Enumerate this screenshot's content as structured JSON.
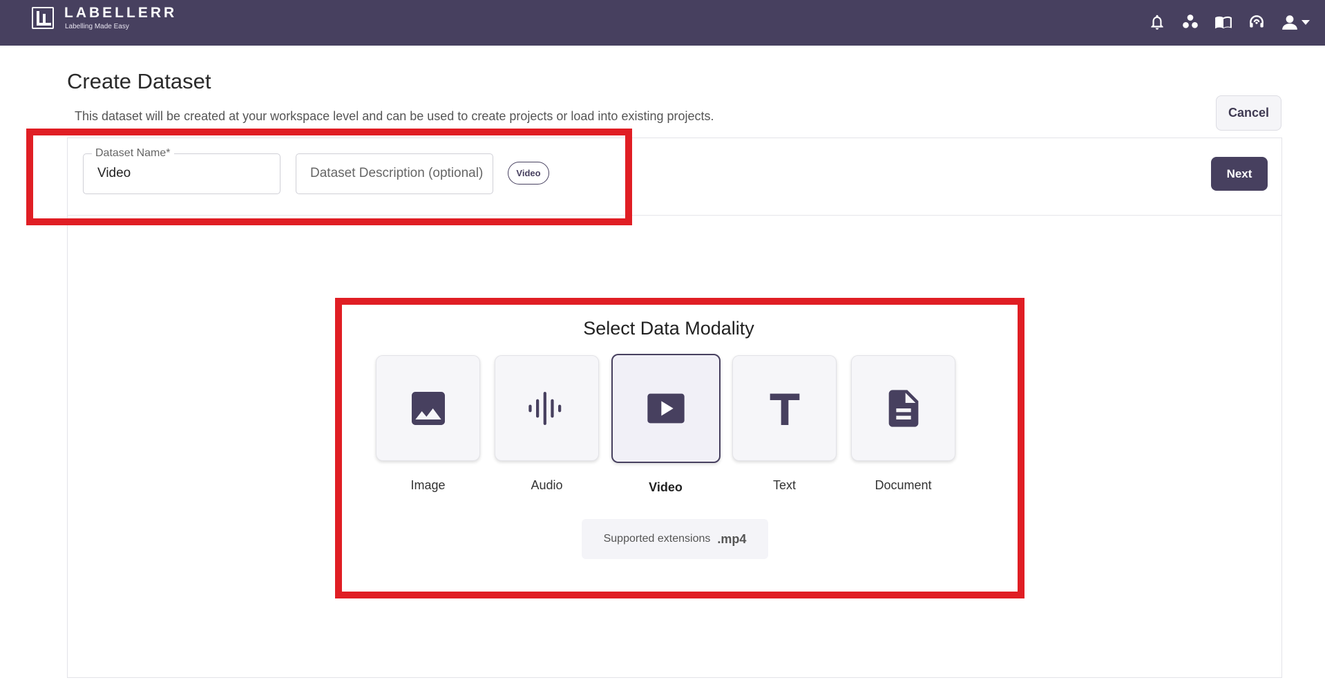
{
  "header": {
    "brand_name": "LABELLERR",
    "brand_tagline": "Labelling Made Easy",
    "icons": [
      "bell-icon",
      "dots-icon",
      "book-icon",
      "headset-icon",
      "user-icon"
    ]
  },
  "page": {
    "title": "Create Dataset",
    "subtitle": "This dataset will be created at your workspace level and can be used to create projects or load into existing projects.",
    "cancel_label": "Cancel",
    "next_label": "Next"
  },
  "form": {
    "name_label": "Dataset Name*",
    "name_value": "Video",
    "description_placeholder": "Dataset Description (optional)",
    "type_chip": "Video"
  },
  "modality": {
    "title": "Select Data Modality",
    "options": [
      {
        "label": "Image",
        "icon": "image-icon"
      },
      {
        "label": "Audio",
        "icon": "audio-icon"
      },
      {
        "label": "Video",
        "icon": "video-icon"
      },
      {
        "label": "Text",
        "icon": "text-icon"
      },
      {
        "label": "Document",
        "icon": "document-icon"
      }
    ],
    "selected": "Video",
    "ext_label": "Supported extensions",
    "ext_value": ".mp4"
  },
  "colors": {
    "brand": "#47405f",
    "highlight": "#e01e24",
    "card_bg": "#f6f6f9"
  }
}
